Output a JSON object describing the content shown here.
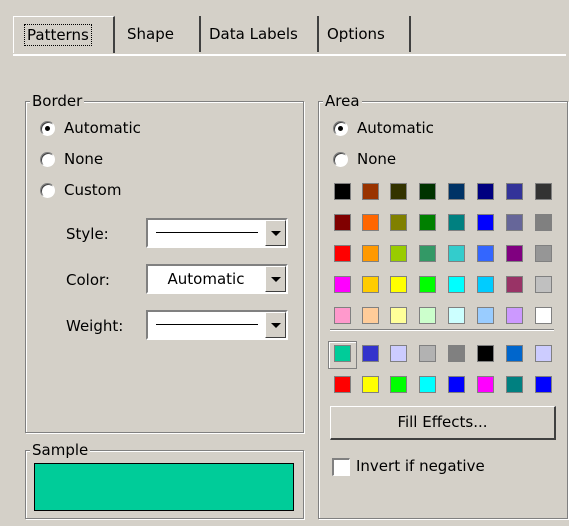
{
  "tabs": [
    {
      "label": "Patterns",
      "selected": true
    },
    {
      "label": "Shape",
      "selected": false
    },
    {
      "label": "Data Labels",
      "selected": false
    },
    {
      "label": "Options",
      "selected": false
    }
  ],
  "border": {
    "legend": "Border",
    "radio_automatic": "Automatic",
    "radio_none": "None",
    "radio_custom": "Custom",
    "selected": "Automatic",
    "style_label": "Style:",
    "color_label": "Color:",
    "color_value": "Automatic",
    "weight_label": "Weight:"
  },
  "area": {
    "legend": "Area",
    "radio_automatic": "Automatic",
    "radio_none": "None",
    "selected": "Automatic",
    "palette_main": [
      "#000000",
      "#993300",
      "#333300",
      "#003300",
      "#003366",
      "#000080",
      "#333399",
      "#333333",
      "#800000",
      "#FF6600",
      "#808000",
      "#008000",
      "#008080",
      "#0000FF",
      "#666699",
      "#808080",
      "#FF0000",
      "#FF9900",
      "#99CC00",
      "#339966",
      "#33CCCC",
      "#3366FF",
      "#800080",
      "#969696",
      "#FF00FF",
      "#FFCC00",
      "#FFFF00",
      "#00FF00",
      "#00FFFF",
      "#00CCFF",
      "#993366",
      "#C0C0C0",
      "#FF99CC",
      "#FFCC99",
      "#FFFF99",
      "#CCFFCC",
      "#CCFFFF",
      "#99CCFF",
      "#CC99FF",
      "#FFFFFF"
    ],
    "palette_chart": [
      "#00CC99",
      "#3333CC",
      "#CCCCFF",
      "#B2B2B2",
      "#808080",
      "#000000",
      "#0066CC",
      "#CCCCFF",
      "#FF0000",
      "#FFFF00",
      "#00FF00",
      "#00FFFF",
      "#0000FF",
      "#FF00FF",
      "#008080",
      "#0000FF"
    ],
    "selected_color": "#00CC99",
    "fill_effects_label": "Fill Effects...",
    "invert_label": "Invert if negative",
    "invert_checked": false
  },
  "sample": {
    "legend": "Sample",
    "fill_color": "#00CC99"
  }
}
